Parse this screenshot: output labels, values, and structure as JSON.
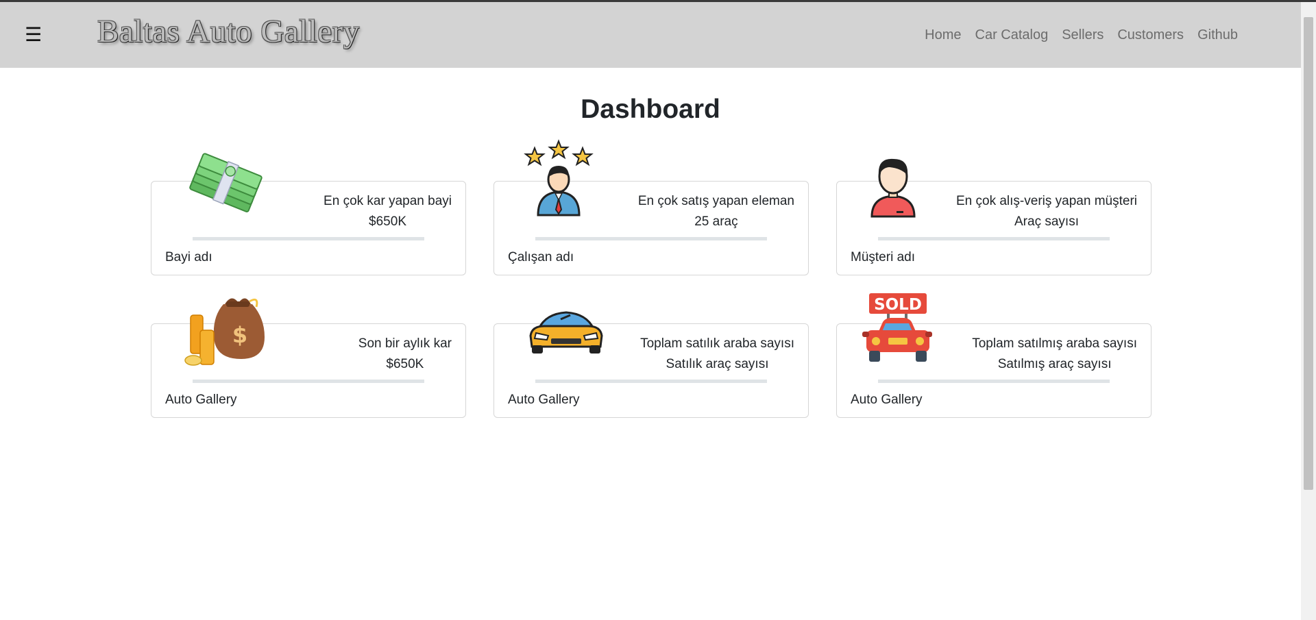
{
  "navbar": {
    "menu_glyph": "☰",
    "brand": "Baltas Auto Gallery",
    "links": [
      "Home",
      "Car Catalog",
      "Sellers",
      "Customers",
      "Github"
    ]
  },
  "page": {
    "title": "Dashboard"
  },
  "cards": [
    {
      "heading": "En çok kar yapan bayi",
      "value": "$650K",
      "footer": "Bayi adı",
      "icon": "money-stack-icon"
    },
    {
      "heading": "En çok satış yapan eleman",
      "value": "25 araç",
      "footer": "Çalışan adı",
      "icon": "star-employee-icon"
    },
    {
      "heading": "En çok alış-veriş yapan müşteri",
      "value": "Araç sayısı",
      "footer": "Müşteri adı",
      "icon": "customer-icon"
    },
    {
      "heading": "Son bir aylık kar",
      "value": "$650K",
      "footer": "Auto Gallery",
      "icon": "money-bag-icon"
    },
    {
      "heading": "Toplam satılık araba sayısı",
      "value": "Satılık araç sayısı",
      "footer": "Auto Gallery",
      "icon": "sports-car-icon"
    },
    {
      "heading": "Toplam satılmış araba sayısı",
      "value": "Satılmış araç sayısı",
      "footer": "Auto Gallery",
      "icon": "sold-car-icon"
    }
  ],
  "sold_sign": "SOLD",
  "colors": {
    "navbar_bg": "#d3d3d3",
    "bar": "#dfe3e6",
    "card_border": "#d6d6d6"
  }
}
